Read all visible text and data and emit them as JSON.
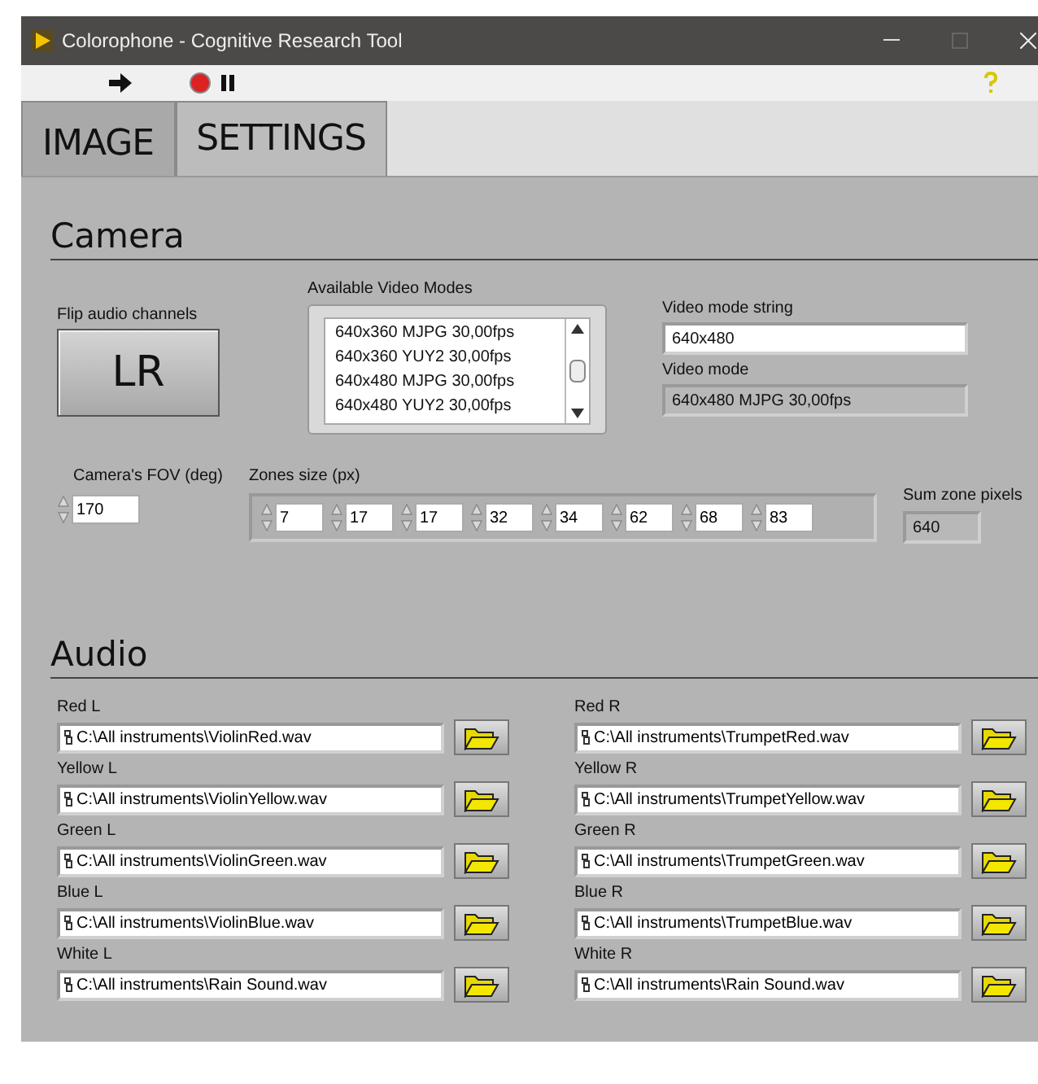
{
  "window": {
    "title": "Colorophone - Cognitive Research Tool"
  },
  "tabs": [
    {
      "label": "IMAGE",
      "selected": false
    },
    {
      "label": "SETTINGS",
      "selected": true
    }
  ],
  "camera": {
    "heading": "Camera",
    "flip_audio": {
      "label": "Flip audio channels",
      "button": "LR"
    },
    "video_modes": {
      "label": "Available Video Modes",
      "items": [
        "640x360 MJPG 30,00fps",
        "640x360 YUY2 30,00fps",
        "640x480 MJPG 30,00fps",
        "640x480 YUY2 30,00fps"
      ]
    },
    "video_mode_string": {
      "label": "Video mode string",
      "value": "640x480"
    },
    "video_mode": {
      "label": "Video mode",
      "value": "640x480 MJPG 30,00fps"
    },
    "fov": {
      "label": "Camera's FOV (deg)",
      "value": "170"
    },
    "zones": {
      "label": "Zones size (px)",
      "values": [
        "7",
        "17",
        "17",
        "32",
        "34",
        "62",
        "68",
        "83"
      ]
    },
    "sum_zone_pixels": {
      "label": "Sum zone pixels",
      "value": "640"
    }
  },
  "audio": {
    "heading": "Audio",
    "channels": [
      {
        "label": "Red L",
        "path": "C:\\All instruments\\ViolinRed.wav"
      },
      {
        "label": "Red R",
        "path": "C:\\All instruments\\TrumpetRed.wav"
      },
      {
        "label": "Yellow L",
        "path": "C:\\All instruments\\ViolinYellow.wav"
      },
      {
        "label": "Yellow R",
        "path": "C:\\All instruments\\TrumpetYellow.wav"
      },
      {
        "label": "Green L",
        "path": "C:\\All instruments\\ViolinGreen.wav"
      },
      {
        "label": "Green R",
        "path": "C:\\All instruments\\TrumpetGreen.wav"
      },
      {
        "label": "Blue L",
        "path": "C:\\All instruments\\ViolinBlue.wav"
      },
      {
        "label": "Blue R",
        "path": "C:\\All instruments\\TrumpetBlue.wav"
      },
      {
        "label": "White L",
        "path": "C:\\All instruments\\Rain Sound.wav"
      },
      {
        "label": "White R",
        "path": "C:\\All instruments\\Rain Sound.wav"
      }
    ]
  }
}
